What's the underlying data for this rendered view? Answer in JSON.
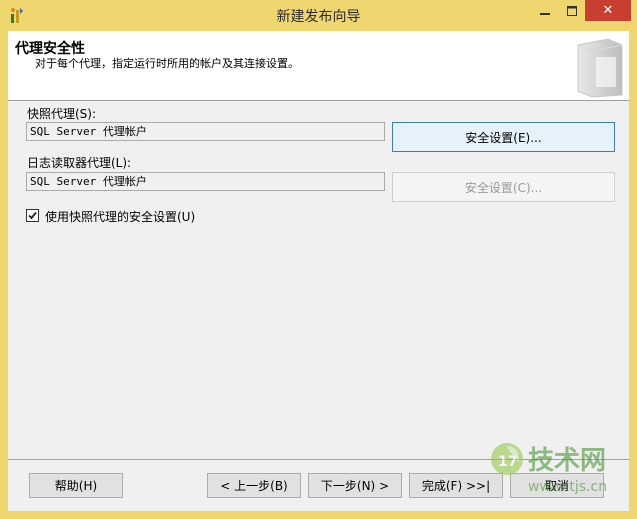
{
  "window": {
    "title": "新建发布向导",
    "close_glyph": "✕",
    "colors": {
      "titlebar": "#efd66e",
      "close": "#c7402f",
      "client": "#f0f0f0",
      "focus_border": "#3c7fb1"
    }
  },
  "header": {
    "title": "代理安全性",
    "description": "对于每个代理，指定运行时所用的帐户及其连接设置。"
  },
  "snapshot": {
    "label": "快照代理(S):",
    "value": "SQL Server 代理帐户",
    "button": "安全设置(E)..."
  },
  "logreader": {
    "label": "日志读取器代理(L):",
    "value": "SQL Server 代理帐户",
    "button": "安全设置(C)..."
  },
  "use_snapshot_security": {
    "label": "使用快照代理的安全设置(U)",
    "checked": true
  },
  "footer": {
    "help": "帮助(H)",
    "back": "< 上一步(B)",
    "next": "下一步(N) >",
    "finish": "完成(F) >>|",
    "cancel": "取消"
  },
  "watermark": {
    "logo_text": "技术网",
    "url": "www.itjs.cn",
    "badge": "17"
  },
  "icons": {
    "app": "wizard-icon",
    "minimize": "minimize-icon",
    "maximize": "maximize-icon",
    "close": "close-icon",
    "header": "server-graphic-icon",
    "checkmark": "checkmark-icon"
  }
}
